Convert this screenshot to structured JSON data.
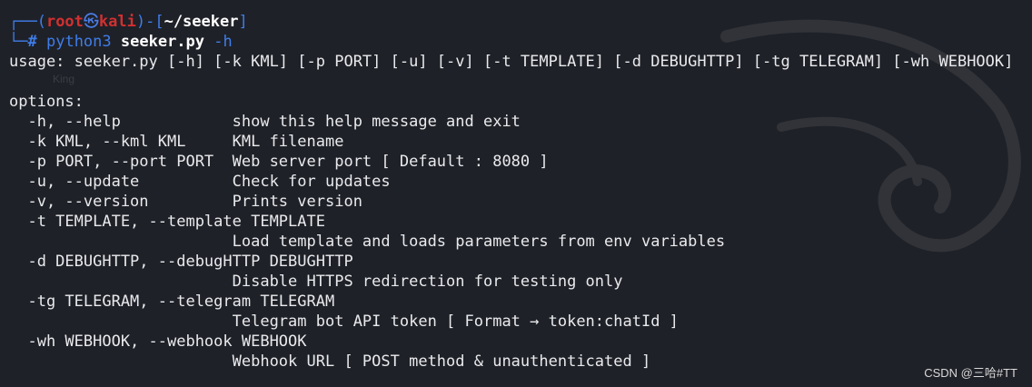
{
  "prompt": {
    "frame_open": "┌──(",
    "user": "root",
    "skull": "㉿",
    "host": "kali",
    "frame_mid": ")-[",
    "path": "~/seeker",
    "frame_close": "]",
    "frame_lower": "└─",
    "hash": "#",
    "command": "python3",
    "script": "seeker.py",
    "flag": "-h"
  },
  "ghost_text": "King",
  "output": {
    "usage": "usage: seeker.py [-h] [-k KML] [-p PORT] [-u] [-v] [-t TEMPLATE] [-d DEBUGHTTP] [-tg TELEGRAM] [-wh WEBHOOK]",
    "blank": "",
    "options_header": "options:",
    "lines": [
      "  -h, --help            show this help message and exit",
      "  -k KML, --kml KML     KML filename",
      "  -p PORT, --port PORT  Web server port [ Default : 8080 ]",
      "  -u, --update          Check for updates",
      "  -v, --version         Prints version",
      "  -t TEMPLATE, --template TEMPLATE",
      "                        Load template and loads parameters from env variables",
      "  -d DEBUGHTTP, --debugHTTP DEBUGHTTP",
      "                        Disable HTTPS redirection for testing only",
      "  -tg TELEGRAM, --telegram TELEGRAM",
      "                        Telegram bot API token [ Format → token:chatId ]",
      "  -wh WEBHOOK, --webhook WEBHOOK",
      "                        Webhook URL [ POST method & unauthenticated ]"
    ]
  },
  "watermark": "CSDN @三哈#TT"
}
